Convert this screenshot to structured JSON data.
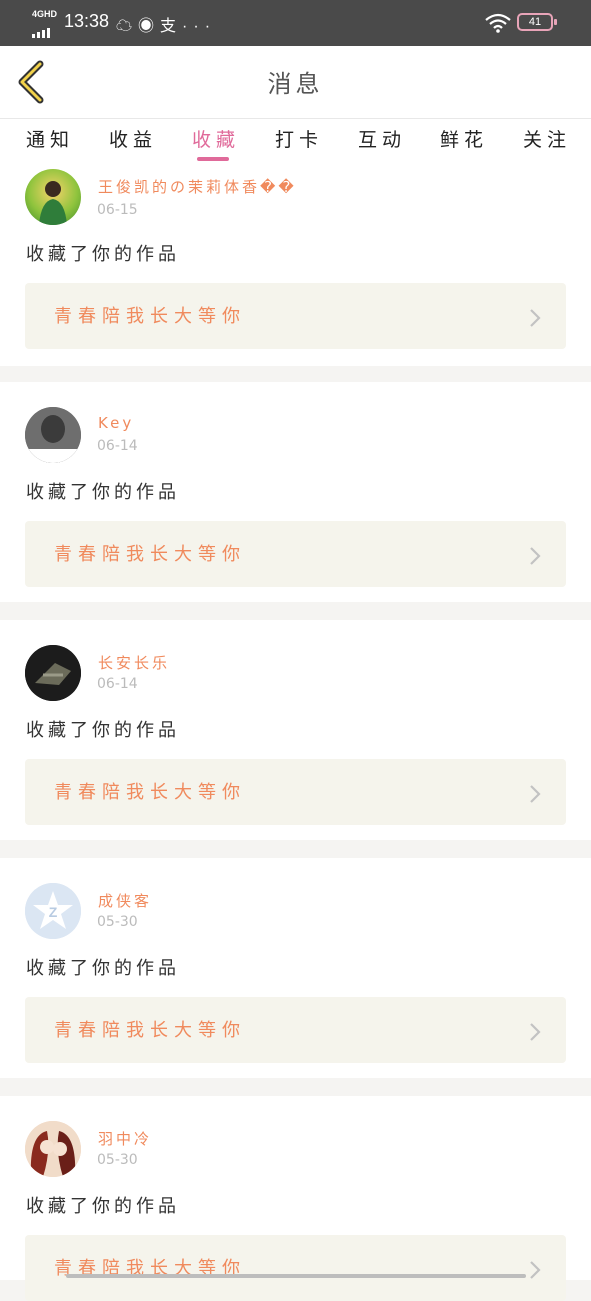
{
  "status_bar": {
    "network": "4G",
    "network_sup": "HD",
    "time": "13:38",
    "icons": [
      "cloud-icon",
      "cat-app-icon",
      "alipay-icon",
      "more-dots-icon"
    ],
    "battery": "41"
  },
  "header": {
    "title": "消息",
    "back_icon": "chevron-left-icon"
  },
  "tabs": [
    {
      "label": "通知",
      "active": false
    },
    {
      "label": "收益",
      "active": false
    },
    {
      "label": "收藏",
      "active": true
    },
    {
      "label": "打卡",
      "active": false
    },
    {
      "label": "互动",
      "active": false
    },
    {
      "label": "鲜花",
      "active": false
    },
    {
      "label": "关注",
      "active": false
    }
  ],
  "messages": [
    {
      "user": "王俊凯的の茉莉体香��",
      "date": "06-15",
      "action": "收藏了你的作品",
      "work": "青春陪我长大等你"
    },
    {
      "user": "Key",
      "date": "06-14",
      "action": "收藏了你的作品",
      "work": "青春陪我长大等你"
    },
    {
      "user": "长安长乐",
      "date": "06-14",
      "action": "收藏了你的作品",
      "work": "青春陪我长大等你"
    },
    {
      "user": "成侠客",
      "date": "05-30",
      "action": "收藏了你的作品",
      "work": "青春陪我长大等你"
    },
    {
      "user": "羽中冷",
      "date": "05-30",
      "action": "收藏了你的作品",
      "work": "青春陪我长大等你"
    }
  ],
  "colors": {
    "accent_pink": "#e06a9a",
    "username_orange": "#f08a5d",
    "work_card_bg": "#f5f4ec",
    "status_bar_bg": "#4a4a4a"
  }
}
